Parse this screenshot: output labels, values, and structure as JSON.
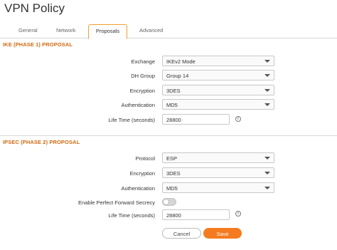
{
  "page": {
    "title": "VPN Policy"
  },
  "tabs": [
    {
      "label": "General"
    },
    {
      "label": "Network"
    },
    {
      "label": "Proposals"
    },
    {
      "label": "Advanced"
    }
  ],
  "active_tab": "Proposals",
  "ike": {
    "heading": "IKE (PHASE 1) PROPOSAL",
    "exchange": {
      "label": "Exchange",
      "value": "IKEv2 Mode"
    },
    "dh_group": {
      "label": "DH Group",
      "value": "Group 14"
    },
    "encryption": {
      "label": "Encryption",
      "value": "3DES"
    },
    "authentication": {
      "label": "Authentication",
      "value": "MD5"
    },
    "lifetime": {
      "label": "Life Time (seconds)",
      "value": "28800"
    }
  },
  "ipsec": {
    "heading": "IPSEC (PHASE 2) PROPOSAL",
    "protocol": {
      "label": "Protocol",
      "value": "ESP"
    },
    "encryption": {
      "label": "Encryption",
      "value": "3DES"
    },
    "authentication": {
      "label": "Authentication",
      "value": "MD5"
    },
    "pfs": {
      "label": "Enable Perfect Forward Secrecy",
      "enabled": false
    },
    "lifetime": {
      "label": "Life Time (seconds)",
      "value": "28800"
    }
  },
  "footer": {
    "cancel_label": "Cancel",
    "save_label": "Save"
  },
  "icons": {
    "info": "info-icon",
    "dropdown": "chevron-down-icon"
  },
  "colors": {
    "accent": "#f47b20",
    "section_heading": "#d06a10",
    "active_tab_border": "#f0a030"
  }
}
